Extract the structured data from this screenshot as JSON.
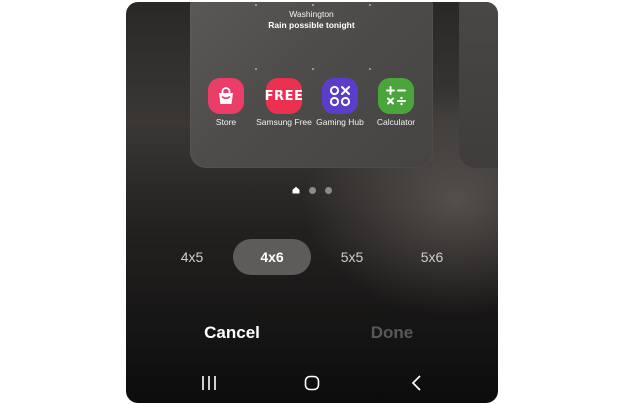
{
  "weather": {
    "city": "Washington",
    "condition": "Rain possible tonight"
  },
  "apps": [
    {
      "label": "Store",
      "icon": "shopping-bag-icon",
      "color": "#ea3d67"
    },
    {
      "label": "Samsung Free",
      "icon": "free-logo-icon",
      "color": "#ec3050",
      "icon_text": "FREE"
    },
    {
      "label": "Gaming Hub",
      "icon": "gaming-hub-icon",
      "color": "#5a3ec9"
    },
    {
      "label": "Calculator",
      "icon": "calculator-icon",
      "color": "#4aa63a"
    }
  ],
  "pager": {
    "pages": [
      "home",
      "page-2",
      "page-3"
    ],
    "current": "home"
  },
  "grid_options": {
    "items": [
      "4x5",
      "4x6",
      "5x5",
      "5x6"
    ],
    "selected": "4x6"
  },
  "actions": {
    "cancel_label": "Cancel",
    "done_label": "Done"
  },
  "navigation": {
    "recents": "recents-icon",
    "home": "home-icon",
    "back": "back-icon"
  },
  "colors": {
    "selected_pill": "#5e5c5b",
    "done_disabled": "#5a5857",
    "cancel": "#ffffff"
  }
}
